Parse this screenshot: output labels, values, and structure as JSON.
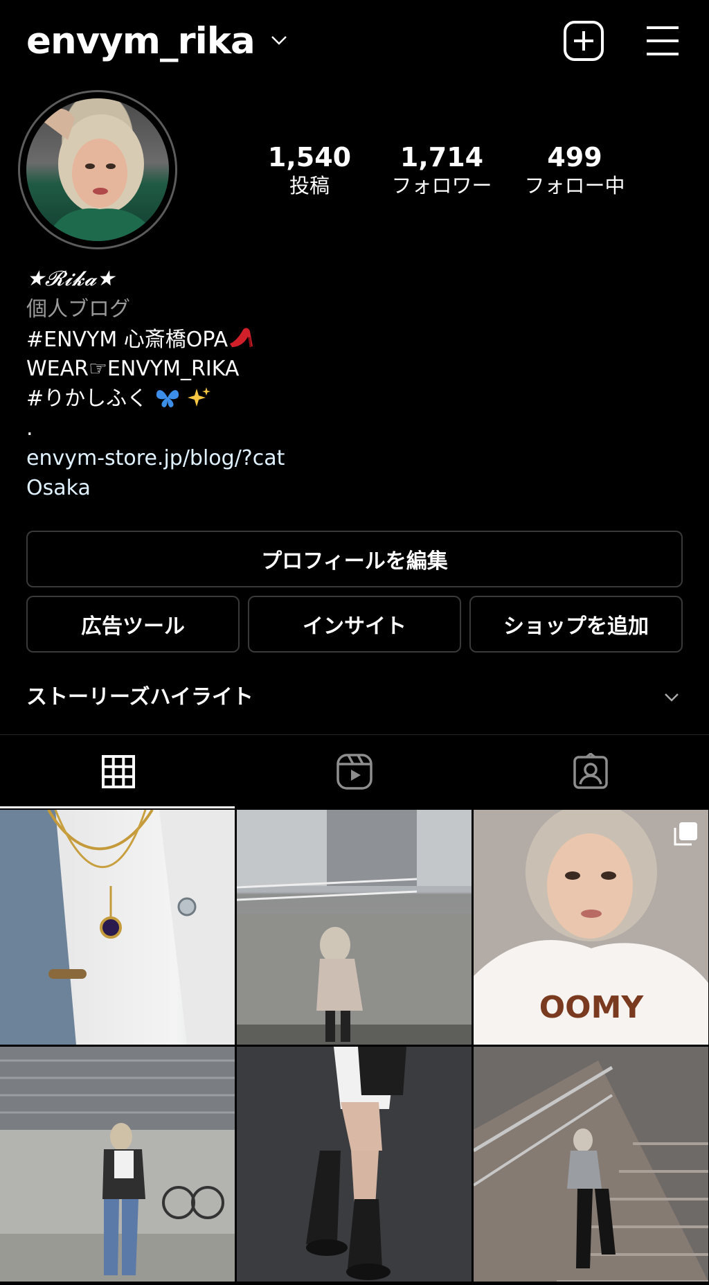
{
  "header": {
    "username": "envym_rika"
  },
  "stats": [
    {
      "value": "1,540",
      "label": "投稿"
    },
    {
      "value": "1,714",
      "label": "フォロワー"
    },
    {
      "value": "499",
      "label": "フォロー中"
    }
  ],
  "bio": {
    "name": "★𝓡𝓲𝓴𝓪★",
    "category": "個人ブログ",
    "line1": "#ENVYM 心斎橋OPA",
    "line2": "WEAR☞ENVYM_RIKA",
    "line3": "#りかしふく",
    "line4": ".",
    "link": "envym-store.jp/blog/?cat",
    "location": "Osaka"
  },
  "buttons": {
    "edit_profile": "プロフィールを編集",
    "ad_tools": "広告ツール",
    "insights": "インサイト",
    "add_shop": "ショップを追加"
  },
  "highlights": {
    "title": "ストーリーズハイライト"
  },
  "tabs": [
    {
      "icon": "grid-icon",
      "active": true
    },
    {
      "icon": "reels-icon",
      "active": false
    },
    {
      "icon": "tagged-icon",
      "active": false
    }
  ],
  "colors": {
    "background": "#000000",
    "link": "#e0f1ff",
    "muted": "#9a9a9a",
    "border": "#3a3a3a"
  }
}
